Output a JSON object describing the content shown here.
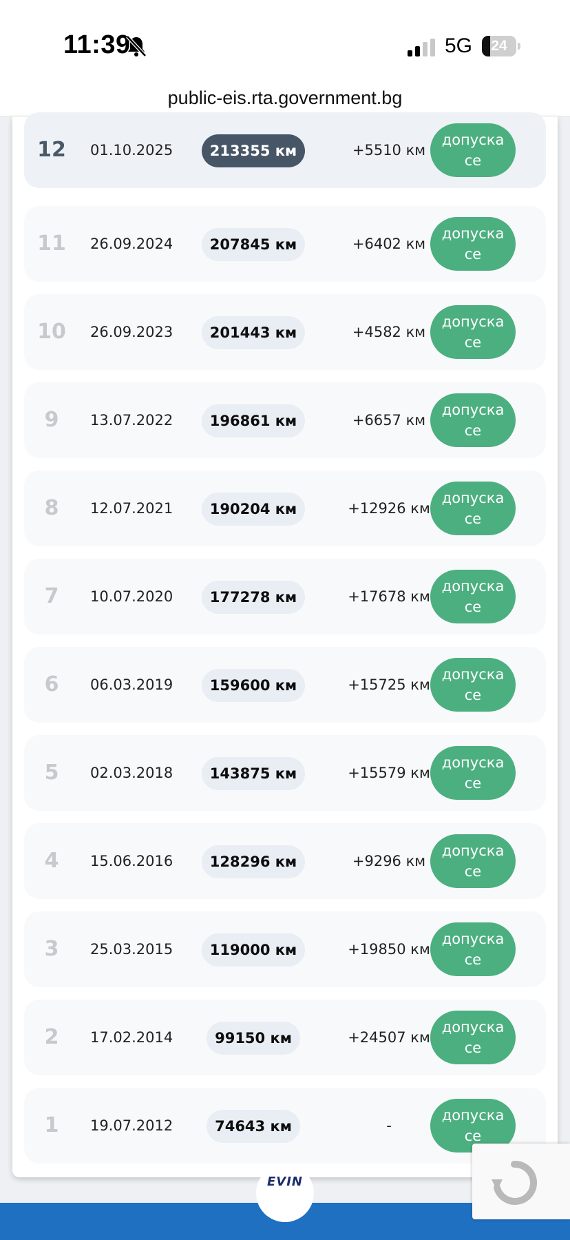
{
  "status_bar": {
    "time": "11:39",
    "network": "5G",
    "battery": "24",
    "battery_level": 0.24,
    "icons": [
      "bell-muted-icon",
      "signal-icon",
      "battery-icon"
    ]
  },
  "browser": {
    "url": "public-eis.rta.government.bg"
  },
  "inspections": [
    {
      "number": "12",
      "date": "01.10.2025",
      "km": "213355 км",
      "delta": "+5510 км",
      "status": "допуска\nсе",
      "current": true
    },
    {
      "number": "11",
      "date": "26.09.2024",
      "km": "207845 км",
      "delta": "+6402 км",
      "status": "допуска\nсе"
    },
    {
      "number": "10",
      "date": "26.09.2023",
      "km": "201443 км",
      "delta": "+4582 км",
      "status": "допуска\nсе"
    },
    {
      "number": "9",
      "date": "13.07.2022",
      "km": "196861 км",
      "delta": "+6657 км",
      "status": "допуска\nсе"
    },
    {
      "number": "8",
      "date": "12.07.2021",
      "km": "190204 км",
      "delta": "+12926 км",
      "status": "допуска\nсе"
    },
    {
      "number": "7",
      "date": "10.07.2020",
      "km": "177278 км",
      "delta": "+17678 км",
      "status": "допуска\nсе"
    },
    {
      "number": "6",
      "date": "06.03.2019",
      "km": "159600 км",
      "delta": "+15725 км",
      "status": "допуска\nсе"
    },
    {
      "number": "5",
      "date": "02.03.2018",
      "km": "143875 км",
      "delta": "+15579 км",
      "status": "допуска\nсе"
    },
    {
      "number": "4",
      "date": "15.06.2016",
      "km": "128296 км",
      "delta": "+9296 км",
      "status": "допуска\nсе"
    },
    {
      "number": "3",
      "date": "25.03.2015",
      "km": "119000 км",
      "delta": "+19850 км",
      "status": "допуска\nсе"
    },
    {
      "number": "2",
      "date": "17.02.2014",
      "km": "99150 км",
      "delta": "+24507 км",
      "status": "допуска\nсе"
    },
    {
      "number": "1",
      "date": "19.07.2012",
      "km": "74643 км",
      "delta": "-",
      "status": "допуска\nсе"
    }
  ],
  "footer": {
    "logo_text": "EVIN",
    "accent_color": "#1f70c1"
  },
  "colors": {
    "status_green": "#4caf80",
    "current_km_pill": "#475666"
  }
}
